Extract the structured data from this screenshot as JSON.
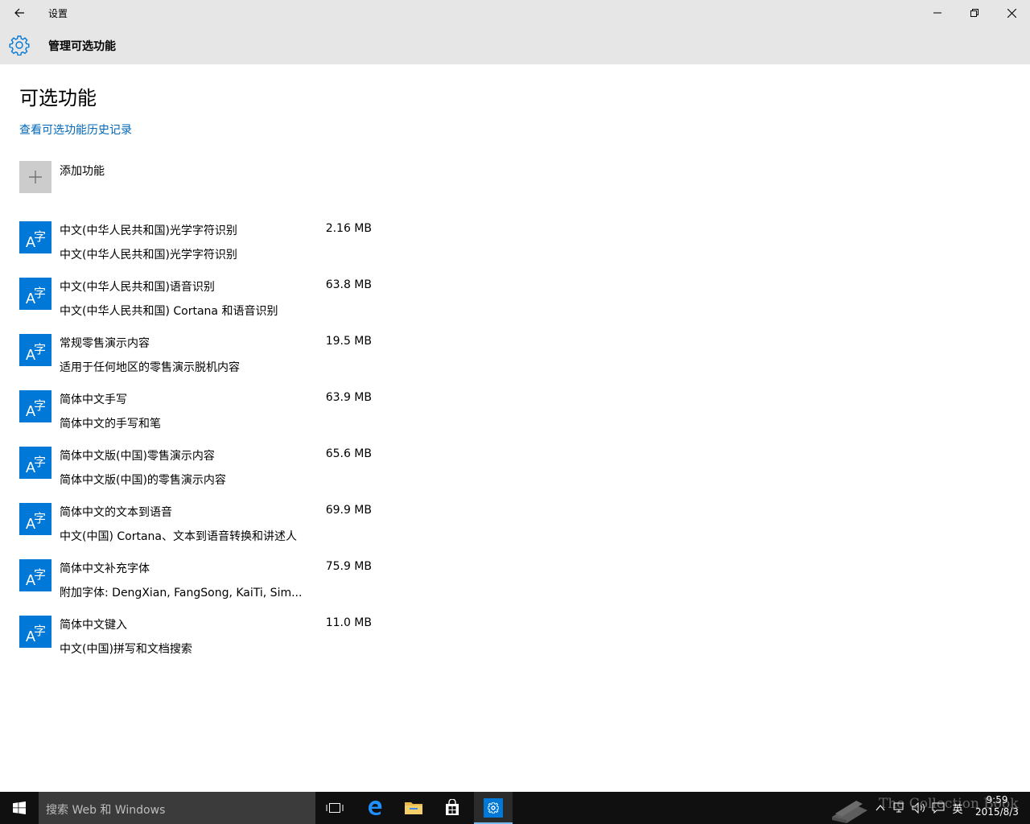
{
  "window": {
    "title": "设置",
    "controls": {
      "minimize": "minimize-icon",
      "maximize": "restore-icon",
      "close": "close-icon"
    }
  },
  "header": {
    "title": "管理可选功能",
    "icon": "gear-icon"
  },
  "main": {
    "page_title": "可选功能",
    "history_link": "查看可选功能历史记录",
    "add_feature_label": "添加功能",
    "features": [
      {
        "name": "中文(中华人民共和国)光学字符识别",
        "description": "中文(中华人民共和国)光学字符识别",
        "size": "2.16 MB"
      },
      {
        "name": "中文(中华人民共和国)语音识别",
        "description": "中文(中华人民共和国) Cortana 和语音识别",
        "size": "63.8 MB"
      },
      {
        "name": "常规零售演示内容",
        "description": "适用于任何地区的零售演示脱机内容",
        "size": "19.5 MB"
      },
      {
        "name": "简体中文手写",
        "description": "简体中文的手写和笔",
        "size": "63.9 MB"
      },
      {
        "name": "简体中文版(中国)零售演示内容",
        "description": "简体中文版(中国)的零售演示内容",
        "size": "65.6 MB"
      },
      {
        "name": "简体中文的文本到语音",
        "description": "中文(中国) Cortana、文本到语音转换和讲述人",
        "size": "69.9 MB"
      },
      {
        "name": "简体中文补充字体",
        "description": "附加字体: DengXian, FangSong, KaiTi, Sim...",
        "size": "75.9 MB"
      },
      {
        "name": "简体中文键入",
        "description": "中文(中国)拼写和文档搜索",
        "size": "11.0 MB"
      }
    ]
  },
  "taskbar": {
    "search_placeholder": "搜索 Web 和 Windows",
    "input_indicator": "英",
    "time": "9:59",
    "date": "2015/8/3",
    "watermark_text": "The Collection Book"
  },
  "colors": {
    "accent": "#0078d7",
    "link": "#0067b8",
    "header_bg": "#e6e6e6",
    "taskbar_bg": "#101010"
  }
}
